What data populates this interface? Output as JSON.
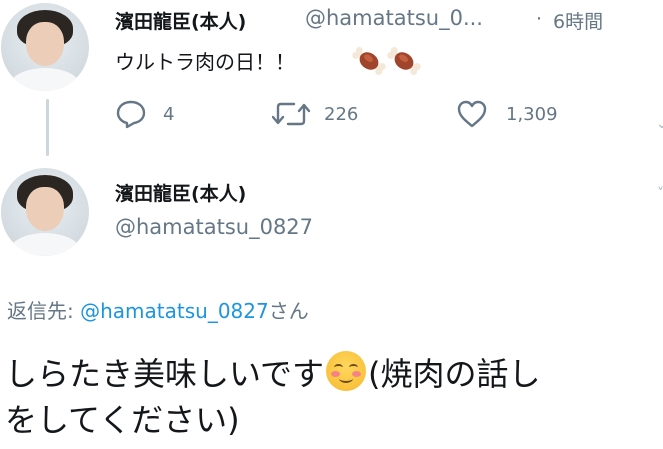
{
  "tweet1": {
    "name": "濱田龍臣(本人)",
    "handle": "@hamatatsu_0...",
    "separator": "·",
    "time": "6時間",
    "text": "ウルトラ肉の日！！",
    "emojis": [
      "meat-on-bone",
      "meat-on-bone"
    ],
    "actions": {
      "reply_count": "4",
      "retweet_count": "226",
      "like_count": "1,309"
    }
  },
  "tweet2": {
    "name": "濱田龍臣(本人)",
    "handle": "@hamatatsu_0827",
    "reply_to_label": "返信先: ",
    "reply_to_mention": "@hamatatsu_0827",
    "reply_to_suffix": "さん",
    "text_part1": "しらたき美味しいです",
    "emoji": "smiling-face-with-blush",
    "text_part2": "(焼肉の話し",
    "text_line2": "をしてください)"
  },
  "colors": {
    "secondary": "#657786",
    "link": "#1b95e0",
    "text": "#14171a",
    "thread_line": "#ccd6dd"
  }
}
